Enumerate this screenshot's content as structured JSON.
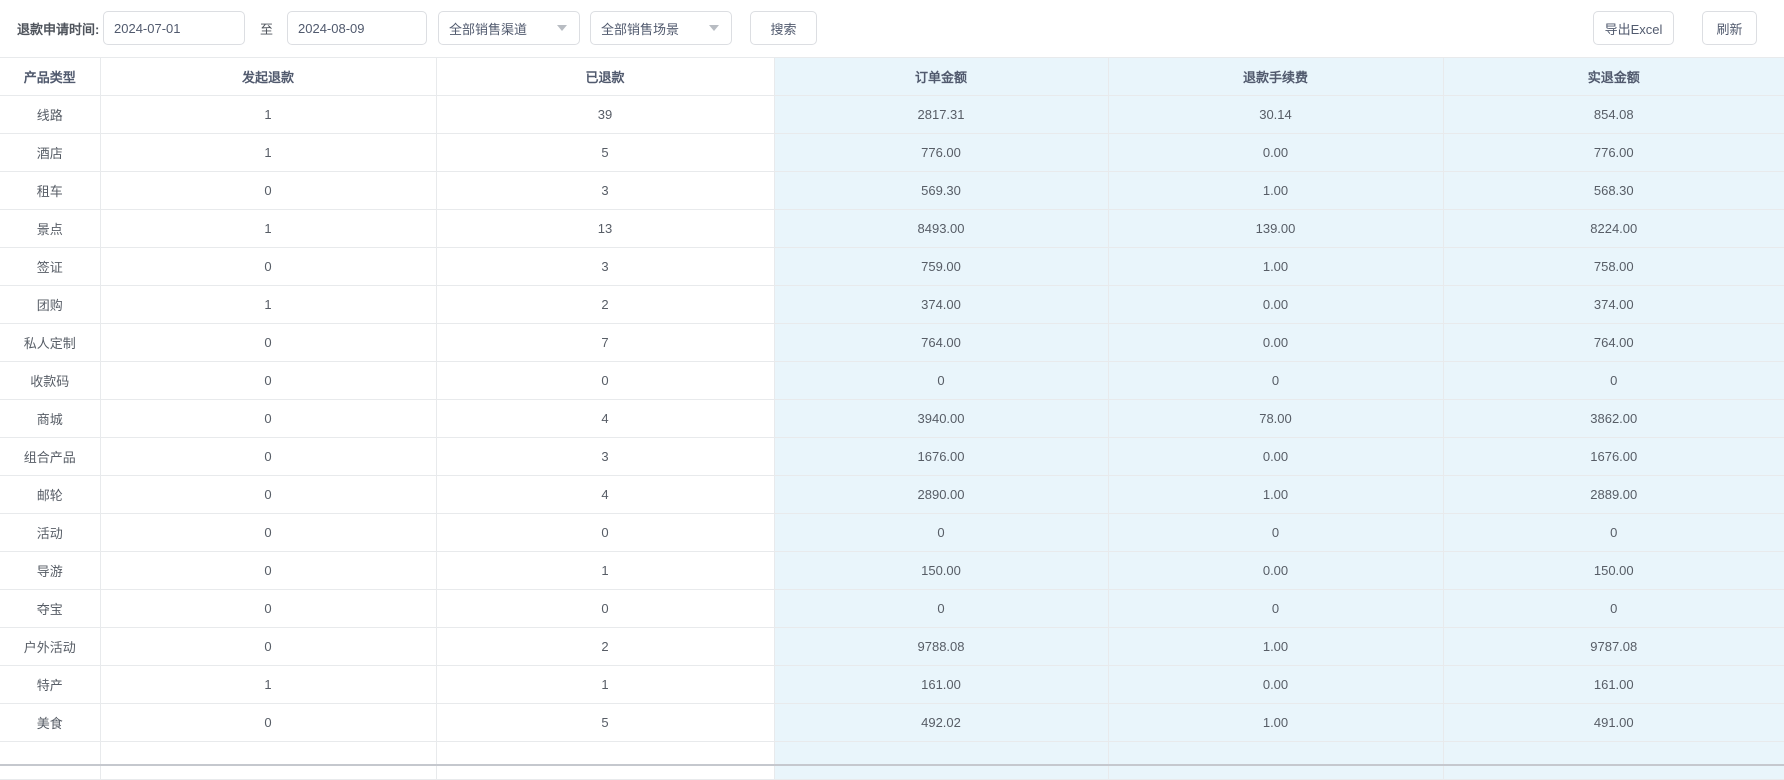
{
  "toolbar": {
    "filter_label": "退款申请时间:",
    "date_from": "2024-07-01",
    "date_separator": "至",
    "date_to": "2024-08-09",
    "channel_select_value": "全部销售渠道",
    "scene_select_value": "全部销售场景",
    "search_label": "搜索",
    "export_label": "导出Excel",
    "refresh_label": "刷新"
  },
  "colors": {
    "highlight_column_bg": "#e9f5fb",
    "row_border": "#e8eaec",
    "input_border": "#dcdee2",
    "text": "#575d66",
    "bottom_divider": "#c5c8ce"
  },
  "table": {
    "columns": [
      "产品类型",
      "发起退款",
      "已退款",
      "订单金额",
      "退款手续费",
      "实退金额"
    ],
    "column_keys": [
      "product-type",
      "initiated-refunds",
      "refunded-count",
      "order-amount",
      "refund-fee",
      "actual-refund-amount"
    ],
    "highlight_from_index": 3,
    "rows": [
      [
        "线路",
        "1",
        "39",
        "2817.31",
        "30.14",
        "854.08"
      ],
      [
        "酒店",
        "1",
        "5",
        "776.00",
        "0.00",
        "776.00"
      ],
      [
        "租车",
        "0",
        "3",
        "569.30",
        "1.00",
        "568.30"
      ],
      [
        "景点",
        "1",
        "13",
        "8493.00",
        "139.00",
        "8224.00"
      ],
      [
        "签证",
        "0",
        "3",
        "759.00",
        "1.00",
        "758.00"
      ],
      [
        "团购",
        "1",
        "2",
        "374.00",
        "0.00",
        "374.00"
      ],
      [
        "私人定制",
        "0",
        "7",
        "764.00",
        "0.00",
        "764.00"
      ],
      [
        "收款码",
        "0",
        "0",
        "0",
        "0",
        "0"
      ],
      [
        "商城",
        "0",
        "4",
        "3940.00",
        "78.00",
        "3862.00"
      ],
      [
        "组合产品",
        "0",
        "3",
        "1676.00",
        "0.00",
        "1676.00"
      ],
      [
        "邮轮",
        "0",
        "4",
        "2890.00",
        "1.00",
        "2889.00"
      ],
      [
        "活动",
        "0",
        "0",
        "0",
        "0",
        "0"
      ],
      [
        "导游",
        "0",
        "1",
        "150.00",
        "0.00",
        "150.00"
      ],
      [
        "夺宝",
        "0",
        "0",
        "0",
        "0",
        "0"
      ],
      [
        "户外活动",
        "0",
        "2",
        "9788.08",
        "1.00",
        "9787.08"
      ],
      [
        "特产",
        "1",
        "1",
        "161.00",
        "0.00",
        "161.00"
      ],
      [
        "美食",
        "0",
        "5",
        "492.02",
        "1.00",
        "491.00"
      ]
    ]
  }
}
